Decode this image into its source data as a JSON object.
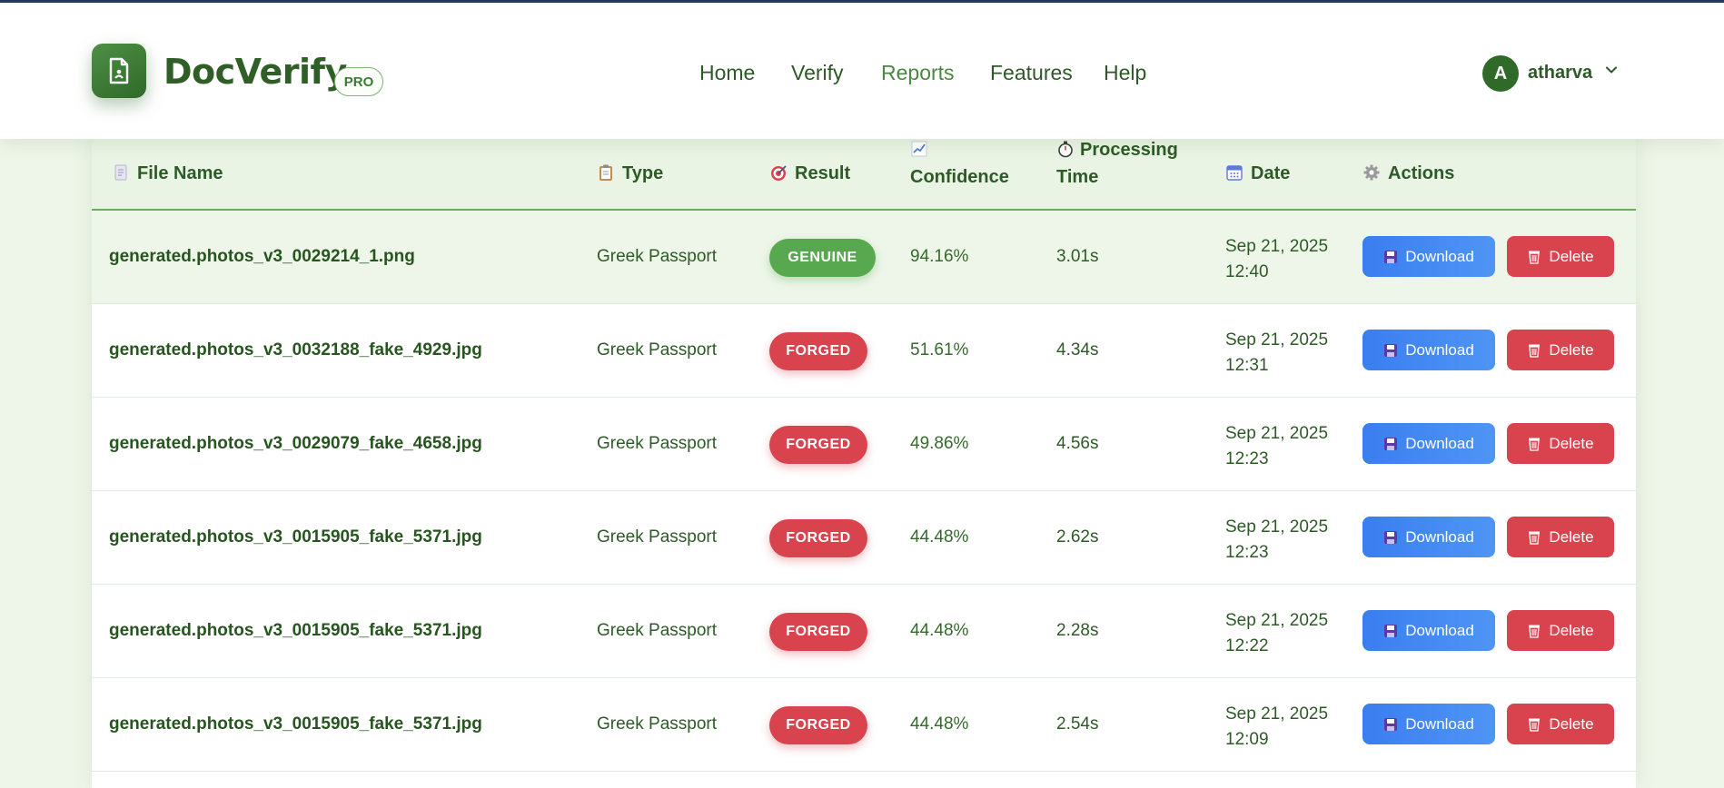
{
  "header": {
    "brand": "DocVerify",
    "badge": "PRO",
    "nav": [
      "Home",
      "Verify",
      "Reports",
      "Features",
      "Help"
    ],
    "active_nav": "Reports",
    "user": {
      "initial": "A",
      "name": "atharva"
    }
  },
  "table": {
    "columns": {
      "file_name": "File Name",
      "type": "Type",
      "result": "Result",
      "confidence": "Confidence",
      "processing_line1": "Processing",
      "processing_line2": "Time",
      "date": "Date",
      "actions": "Actions"
    },
    "download_label": "Download",
    "delete_label": "Delete",
    "rows": [
      {
        "file": "generated.photos_v3_0029214_1.png",
        "type": "Greek Passport",
        "result": "GENUINE",
        "confidence": "94.16%",
        "time": "3.01s",
        "date": "Sep 21, 2025 12:40"
      },
      {
        "file": "generated.photos_v3_0032188_fake_4929.jpg",
        "type": "Greek Passport",
        "result": "FORGED",
        "confidence": "51.61%",
        "time": "4.34s",
        "date": "Sep 21, 2025 12:31"
      },
      {
        "file": "generated.photos_v3_0029079_fake_4658.jpg",
        "type": "Greek Passport",
        "result": "FORGED",
        "confidence": "49.86%",
        "time": "4.56s",
        "date": "Sep 21, 2025 12:23"
      },
      {
        "file": "generated.photos_v3_0015905_fake_5371.jpg",
        "type": "Greek Passport",
        "result": "FORGED",
        "confidence": "44.48%",
        "time": "2.62s",
        "date": "Sep 21, 2025 12:23"
      },
      {
        "file": "generated.photos_v3_0015905_fake_5371.jpg",
        "type": "Greek Passport",
        "result": "FORGED",
        "confidence": "44.48%",
        "time": "2.28s",
        "date": "Sep 21, 2025 12:22"
      },
      {
        "file": "generated.photos_v3_0015905_fake_5371.jpg",
        "type": "Greek Passport",
        "result": "FORGED",
        "confidence": "44.48%",
        "time": "2.54s",
        "date": "Sep 21, 2025 12:09"
      }
    ]
  },
  "colors": {
    "brand_green": "#2f6a29",
    "genuine": "#58a84f",
    "forged": "#d9434e",
    "download": "#3a7ef0"
  }
}
